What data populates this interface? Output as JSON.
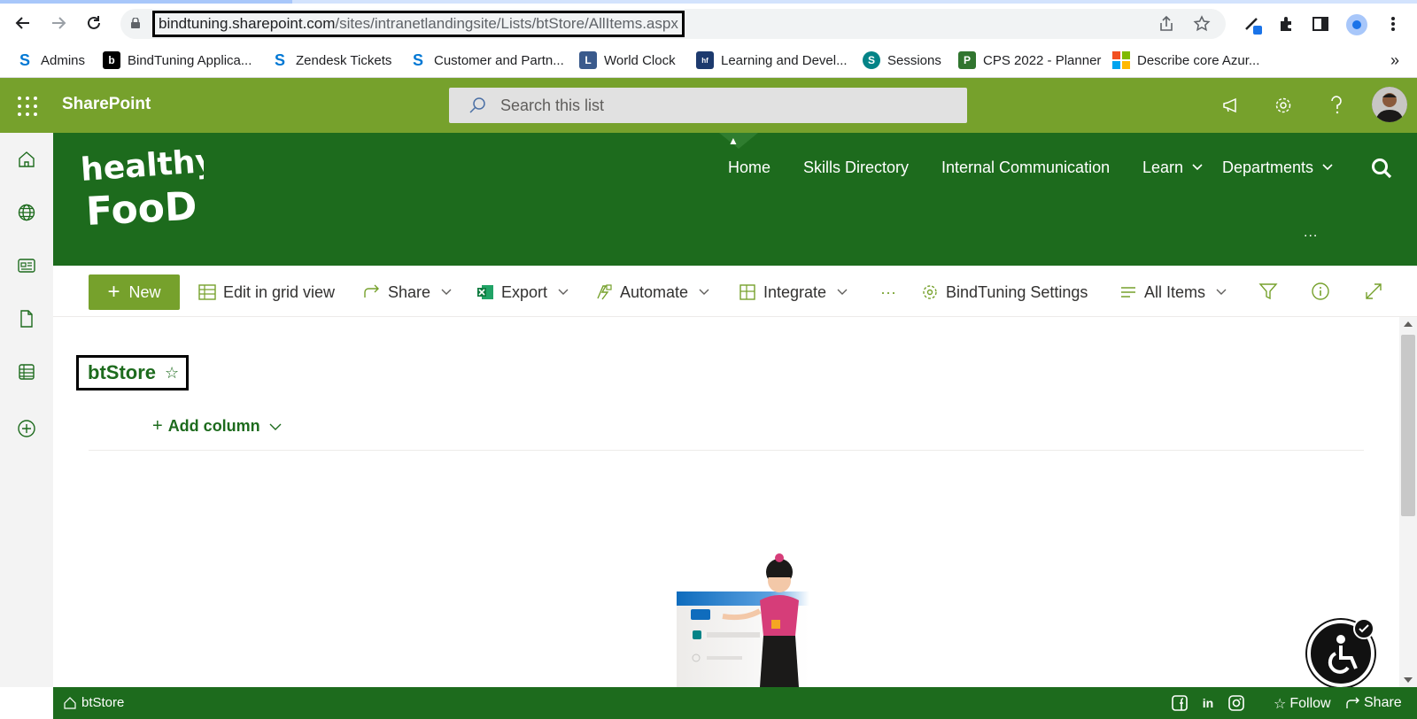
{
  "browser": {
    "url_host": "bindtuning.sharepoint.com",
    "url_path": "/sites/intranetlandingsite/Lists/btStore/AllItems.aspx",
    "bookmarks": [
      {
        "label": "Admins",
        "icon": "sharepoint-s-icon",
        "color": "#0078d4"
      },
      {
        "label": "BindTuning Applica...",
        "icon": "bindtuning-icon",
        "color": "#000000"
      },
      {
        "label": "Zendesk Tickets",
        "icon": "sharepoint-s-icon",
        "color": "#0078d4"
      },
      {
        "label": "Customer and Partn...",
        "icon": "sharepoint-s-icon",
        "color": "#0078d4"
      },
      {
        "label": "World Clock",
        "icon": "clock-icon",
        "color": "#3a5a8c"
      },
      {
        "label": "Learning and Devel...",
        "icon": "healthy-food-icon",
        "color": "#1d6b1d"
      },
      {
        "label": "Sessions",
        "icon": "sharepoint-icon",
        "color": "#038387"
      },
      {
        "label": "CPS 2022 - Planner",
        "icon": "planner-icon",
        "color": "#31752f"
      },
      {
        "label": "Describe core Azur...",
        "icon": "microsoft-icon",
        "color": "#f25022"
      }
    ],
    "bookmarks_more": "»"
  },
  "suitebar": {
    "brand": "SharePoint",
    "search_placeholder": "Search this list",
    "color": "#76a12c"
  },
  "site": {
    "logo_line1": "healthy",
    "logo_line2": "FooD",
    "nav": [
      {
        "label": "Home",
        "has_dropdown": false
      },
      {
        "label": "Skills Directory",
        "has_dropdown": false
      },
      {
        "label": "Internal Communication",
        "has_dropdown": false
      },
      {
        "label": "Learn",
        "has_dropdown": true
      },
      {
        "label": "Departments",
        "has_dropdown": true
      }
    ],
    "header_more": "...",
    "header_color": "#1d6b1d"
  },
  "commandbar": {
    "new_label": "New",
    "edit_grid_label": "Edit in grid view",
    "share_label": "Share",
    "export_label": "Export",
    "automate_label": "Automate",
    "integrate_label": "Integrate",
    "more_label": "···",
    "bindtuning_settings_label": "BindTuning Settings",
    "view_label": "All Items"
  },
  "list": {
    "title": "btStore",
    "favorite_glyph": "☆",
    "add_column_label": "Add column"
  },
  "footer": {
    "breadcrumb": "btStore",
    "follow_label": "Follow",
    "share_label": "Share"
  }
}
